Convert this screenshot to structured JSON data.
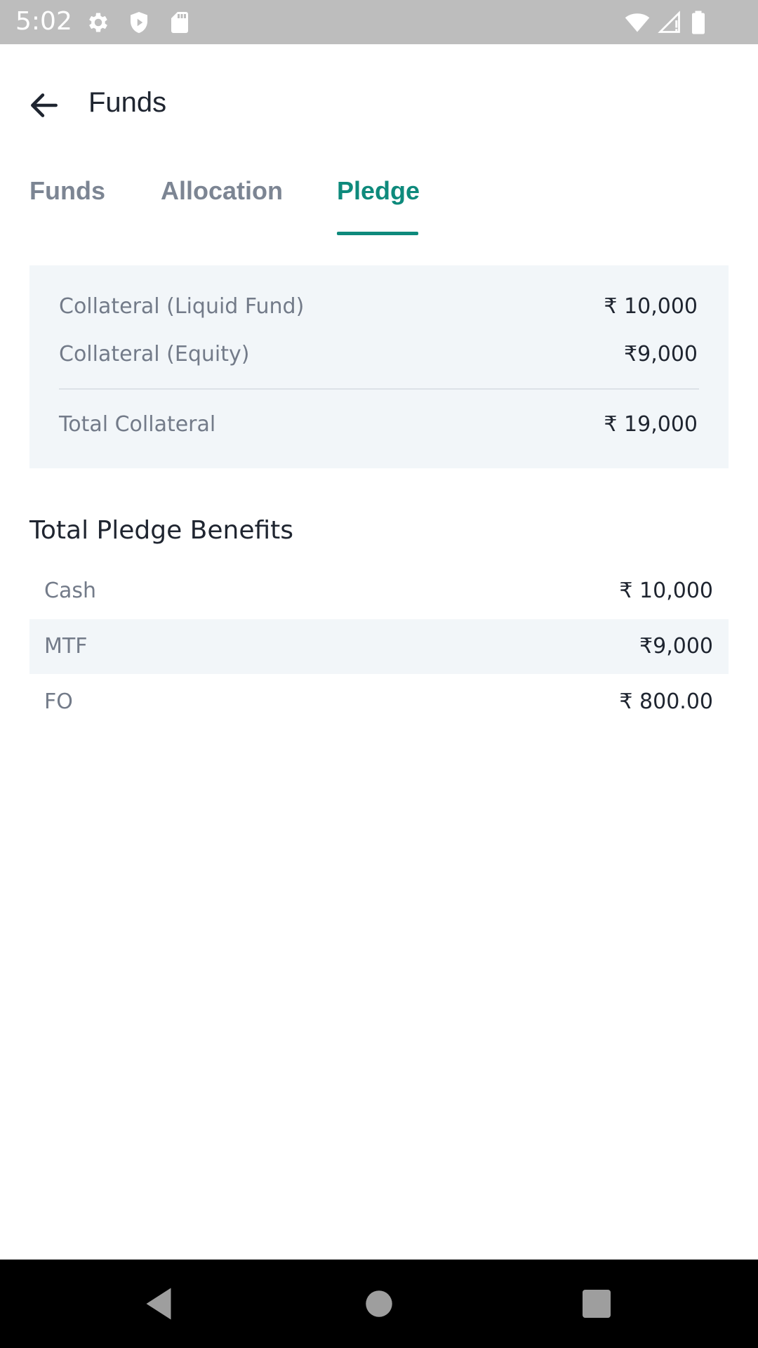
{
  "status_bar": {
    "time": "5:02",
    "icons": [
      "settings-icon",
      "shield-icon",
      "sd-card-icon",
      "wifi-icon",
      "signal-icon",
      "battery-icon"
    ],
    "background": "#bdbdbd"
  },
  "app_bar": {
    "title": "Funds",
    "back_icon": "arrow-left-icon"
  },
  "tabs": {
    "items": [
      {
        "label": "Funds",
        "active": false
      },
      {
        "label": "Allocation",
        "active": false
      },
      {
        "label": "Pledge",
        "active": true
      }
    ],
    "active_color": "#0e8a7c",
    "inactive_color": "#7c8593"
  },
  "collateral": {
    "rows": [
      {
        "label": "Collateral (Liquid Fund)",
        "value": "₹ 10,000"
      },
      {
        "label": "Collateral (Equity)",
        "value": "₹9,000"
      }
    ],
    "total": {
      "label": "Total Collateral",
      "value": "₹ 19,000"
    },
    "background": "#f2f6f9"
  },
  "benefits": {
    "title": "Total Pledge Benefits",
    "rows": [
      {
        "label": "Cash",
        "value": "₹ 10,000"
      },
      {
        "label": "MTF",
        "value": "₹9,000"
      },
      {
        "label": "FO",
        "value": "₹ 800.00"
      }
    ]
  },
  "nav_bar": {
    "buttons": [
      "back-triangle-icon",
      "home-circle-icon",
      "recents-square-icon"
    ],
    "background": "#000000"
  }
}
